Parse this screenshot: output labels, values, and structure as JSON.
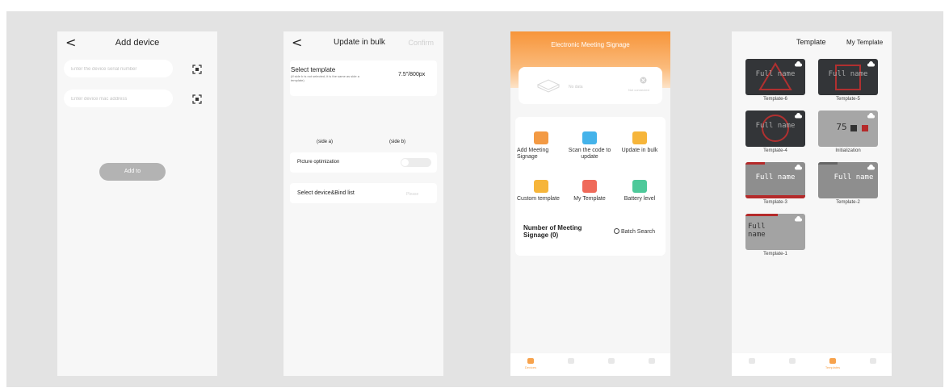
{
  "screen1": {
    "back_glyph": "<",
    "title": "Add device",
    "serial_placeholder": "Enter the device serial number",
    "mac_placeholder": "Enter device mac address",
    "add_button": "Add to",
    "scan_icon": "scan-icon"
  },
  "screen2": {
    "back_glyph": "<",
    "title": "Update in bulk",
    "confirm": "Confirm",
    "select_template_label": "Select template",
    "select_template_note": "(If side b is not selected, it is the same as side a template)",
    "template_size": "7.5\"/800px",
    "side_a": "(side a)",
    "side_b": "(side b)",
    "picture_optimization": "Picture optimization",
    "select_device": "Select device&Bind list",
    "select_value": "Please"
  },
  "screen3": {
    "title": "Electronic Meeting Signage",
    "no_data": "No data",
    "unlinked": "Not connected",
    "menu": [
      {
        "label": "Add Meeting Signage",
        "icon": "add-signage-icon",
        "color": "#f39a44"
      },
      {
        "label": "Scan the code to update",
        "icon": "scan-update-icon",
        "color": "#44b3ea"
      },
      {
        "label": "Update in bulk",
        "icon": "bulk-update-icon",
        "color": "#f6b53a"
      },
      {
        "label": "Custom template",
        "icon": "custom-template-icon",
        "color": "#f6b53a"
      },
      {
        "label": "My Template",
        "icon": "my-template-icon",
        "color": "#ef6a5a"
      },
      {
        "label": "Battery level",
        "icon": "battery-icon",
        "color": "#4ec99a"
      }
    ],
    "count_label": "Number of Meeting Signage (0)",
    "batch_search": "Batch Search",
    "tabs": [
      {
        "label": "Devices",
        "active": true
      },
      {
        "label": "",
        "active": false
      },
      {
        "label": "",
        "active": false
      },
      {
        "label": "",
        "active": false
      }
    ],
    "accent": "#f7953a"
  },
  "screen4": {
    "tab_template": "Template",
    "tab_my_template": "My Template",
    "templates": [
      {
        "name": "Template-6",
        "text": "Full name",
        "style": "dark-triangle"
      },
      {
        "name": "Template-5",
        "text": "Full name",
        "style": "dark-square"
      },
      {
        "name": "Template-4",
        "text": "Full name",
        "style": "dark-circle"
      },
      {
        "name": "Initialization",
        "text": "75",
        "style": "gray-init"
      },
      {
        "name": "Template-3",
        "text": "Full name",
        "style": "gray-red"
      },
      {
        "name": "Template-2",
        "text": "Full name",
        "style": "gray-plain"
      },
      {
        "name": "Template-1",
        "text": "Full name",
        "style": "gray-red-head"
      }
    ],
    "bottom_tabs": [
      {
        "label": "",
        "active": false
      },
      {
        "label": "",
        "active": false
      },
      {
        "label": "Templates",
        "active": true
      },
      {
        "label": "",
        "active": false
      }
    ]
  }
}
